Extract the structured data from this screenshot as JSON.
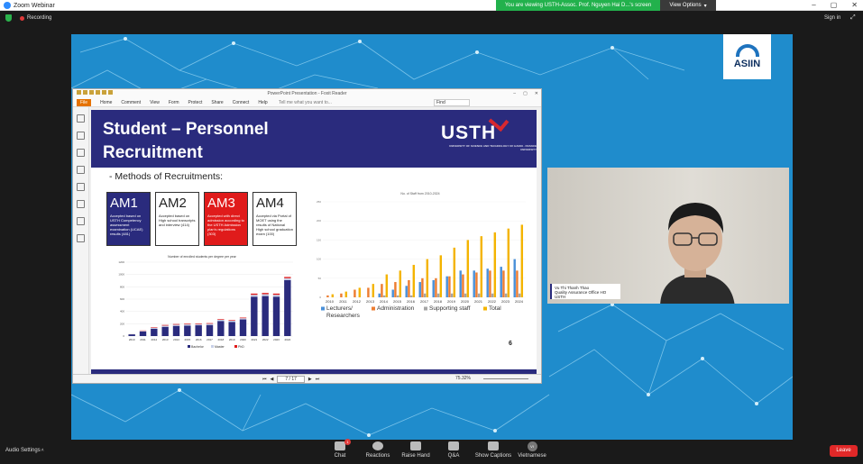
{
  "window": {
    "title": "Zoom Webinar",
    "viewing_banner": "You are viewing USTH-Assoc. Prof. Nguyen Hai D...'s screen",
    "view_options": "View Options",
    "recording": "Recording",
    "sign_in": "Sign in"
  },
  "reader": {
    "title": "PowerPoint Presentation - Foxit Reader",
    "menu": [
      "File",
      "Home",
      "Comment",
      "View",
      "Form",
      "Protect",
      "Share",
      "Connect",
      "Help"
    ],
    "tell_me": "Tell me what you want to...",
    "find": "Find",
    "page_value": "7 / 17",
    "zoom": "75.32%"
  },
  "slide": {
    "title_line1": "Student – Personnel",
    "title_line2": "Recruitment",
    "logo": "USTH",
    "logo_sub": "UNIVERSITY OF SCIENCE AND TECHNOLOGY OF HANOI · FRANCE UNIVERSITY",
    "methods_heading": "- Methods of Recruitments:",
    "am": [
      {
        "code": "AM1",
        "desc": "Accepted based on USTH Competency assessment examination (UCAE) results (481)"
      },
      {
        "code": "AM2",
        "desc": "Accepted based on High school transcripts and interview (414)"
      },
      {
        "code": "AM3",
        "desc": "Accepted with direct admission according to the USTH Admission plan's regulations (303)"
      },
      {
        "code": "AM4",
        "desc": "Accepted via Portal of MOET using the results of National High school graduation exam (100)"
      }
    ],
    "page_number": "6"
  },
  "chart_data": [
    {
      "type": "bar",
      "title": "Number of enrolled students per degree per year",
      "categories": [
        "2010",
        "2011",
        "2012",
        "2013",
        "2014",
        "2015",
        "2016",
        "2017",
        "2018",
        "2019",
        "2020",
        "2021",
        "2022",
        "2023",
        "2024"
      ],
      "series": [
        {
          "name": "Bachelor",
          "values": [
            28,
            75,
            120,
            150,
            165,
            170,
            175,
            180,
            245,
            230,
            270,
            640,
            650,
            640,
            910
          ]
        },
        {
          "name": "Master",
          "values": [
            2,
            10,
            15,
            20,
            20,
            20,
            20,
            20,
            20,
            20,
            20,
            30,
            30,
            30,
            30
          ]
        },
        {
          "name": "PhD",
          "values": [
            1,
            5,
            8,
            10,
            10,
            10,
            10,
            10,
            10,
            10,
            10,
            20,
            20,
            20,
            20
          ]
        }
      ],
      "ylim": [
        0,
        1200
      ],
      "yticks": [
        0,
        200,
        400,
        600,
        800,
        1000,
        1200
      ],
      "legend": "bottom",
      "colors": {
        "Bachelor": "#2a2b7d",
        "Master": "#c8d0e8",
        "PhD": "#e01b1b"
      }
    },
    {
      "type": "bar",
      "title": "No. of Staff from 2010-2024",
      "categories": [
        "2010",
        "2011",
        "2012",
        "2013",
        "2014",
        "2015",
        "2016",
        "2017",
        "2018",
        "2019",
        "2020",
        "2021",
        "2022",
        "2023",
        "2024"
      ],
      "series": [
        {
          "name": "Lecturers/ Researchers",
          "values": [
            0,
            0,
            0,
            0,
            10,
            20,
            30,
            40,
            45,
            55,
            70,
            70,
            75,
            80,
            100
          ]
        },
        {
          "name": "Administration",
          "values": [
            5,
            10,
            20,
            25,
            35,
            40,
            45,
            50,
            50,
            55,
            60,
            65,
            70,
            70,
            70
          ]
        },
        {
          "name": "Supporting staff",
          "values": [
            0,
            0,
            0,
            0,
            5,
            5,
            5,
            10,
            10,
            10,
            10,
            10,
            10,
            10,
            10
          ]
        },
        {
          "name": "Total",
          "values": [
            8,
            15,
            25,
            35,
            60,
            70,
            85,
            100,
            110,
            130,
            150,
            160,
            170,
            180,
            190
          ]
        }
      ],
      "ylim": [
        0,
        250
      ],
      "yticks": [
        0,
        50,
        100,
        150,
        200,
        250
      ],
      "legend": "bottom",
      "colors": {
        "Lecturers/ Researchers": "#4a90d9",
        "Administration": "#ed7d31",
        "Supporting staff": "#a5a5a5",
        "Total": "#f4b400"
      }
    }
  ],
  "presenter": {
    "name": "Vu Thi Thanh Thao",
    "role": "Quality Assurance Office HO USTH"
  },
  "toolbar": {
    "audio_settings": "Audio Settings",
    "items": [
      {
        "label": "Chat",
        "icon": "chat-icon",
        "badge": "1"
      },
      {
        "label": "Reactions",
        "icon": "reactions-icon"
      },
      {
        "label": "Raise Hand",
        "icon": "hand-icon"
      },
      {
        "label": "Q&A",
        "icon": "qa-icon"
      },
      {
        "label": "Show Captions",
        "icon": "captions-icon"
      },
      {
        "label": "Vietnamese",
        "icon": "language-icon",
        "avatar": "VI"
      }
    ],
    "leave": "Leave"
  },
  "colors": {
    "stage": "#1f8ccc",
    "slide_header": "#2a2b7d",
    "banner": "#22b14c",
    "leave": "#e02828"
  }
}
